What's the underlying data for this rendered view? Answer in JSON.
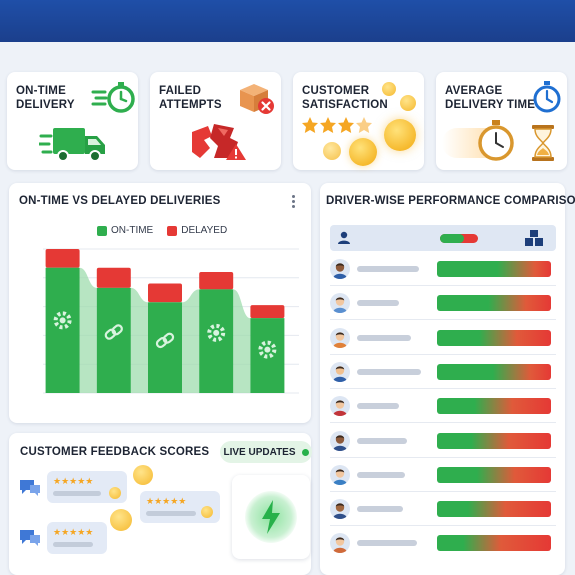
{
  "kpis": [
    {
      "title": "ON-TIME\nDELIVERY",
      "icon": "truck-icon",
      "accent": "#2fae4e"
    },
    {
      "title": "FAILED\nATTEMPTS",
      "icon": "broken-box-icon",
      "accent": "#e53935"
    },
    {
      "title": "CUSTOMER\nSATISFACTION",
      "icon": "smiley-stars-icon",
      "accent": "#f5a623"
    },
    {
      "title": "AVERAGE\nDELIVERY TIME",
      "icon": "stopwatch-icon",
      "accent": "#1f6fd1"
    }
  ],
  "delivery_chart": {
    "title": "ON-TIME VS DELAYED DELIVERIES",
    "legend": [
      {
        "label": "ON-TIME",
        "color": "#2fae4e"
      },
      {
        "label": "DELAYED",
        "color": "#e53935"
      }
    ]
  },
  "chart_data": {
    "type": "bar",
    "categories": [
      "",
      "",
      "",
      "",
      ""
    ],
    "series": [
      {
        "name": "ON-TIME",
        "values": [
          87,
          73,
          63,
          72,
          52
        ]
      },
      {
        "name": "DELAYED",
        "values": [
          13,
          14,
          13,
          12,
          9
        ]
      }
    ],
    "stacked": true,
    "grid": true,
    "icons": [
      "gear-icon",
      "link-icon",
      "broken-link-icon",
      "gear-icon",
      "gear-icon"
    ],
    "colors": {
      "on_time": "#2fae4e",
      "delayed": "#e53935"
    }
  },
  "driver_panel": {
    "title": "DRIVER-WISE PERFORMANCE COMPARISON",
    "header_icons": [
      "person-icon",
      "progress-pill-icon",
      "boxes-icon"
    ],
    "drivers": [
      {
        "avatar_color": "#2f5fa8",
        "skin": "#8d5a3b",
        "performance": 0.78
      },
      {
        "avatar_color": "#5a8fd0",
        "skin": "#f2c7a0",
        "performance": 0.7
      },
      {
        "avatar_color": "#e0813a",
        "skin": "#f2c7a0",
        "performance": 0.62
      },
      {
        "avatar_color": "#2f5fa8",
        "skin": "#f0c090",
        "performance": 0.74
      },
      {
        "avatar_color": "#c2353a",
        "skin": "#f2c7a0",
        "performance": 0.58
      },
      {
        "avatar_color": "#2f4f8a",
        "skin": "#8d5a3b",
        "performance": 0.55
      },
      {
        "avatar_color": "#3a7fc4",
        "skin": "#f2c7a0",
        "performance": 0.6
      },
      {
        "avatar_color": "#2f4f8a",
        "skin": "#a0673f",
        "performance": 0.52
      },
      {
        "avatar_color": "#d06a3a",
        "skin": "#f2c7a0",
        "performance": 0.48
      }
    ]
  },
  "feedback": {
    "title": "CUSTOMER FEEDBACK SCORES",
    "live_label": "LIVE UPDATES",
    "stars": "★★★★★"
  }
}
